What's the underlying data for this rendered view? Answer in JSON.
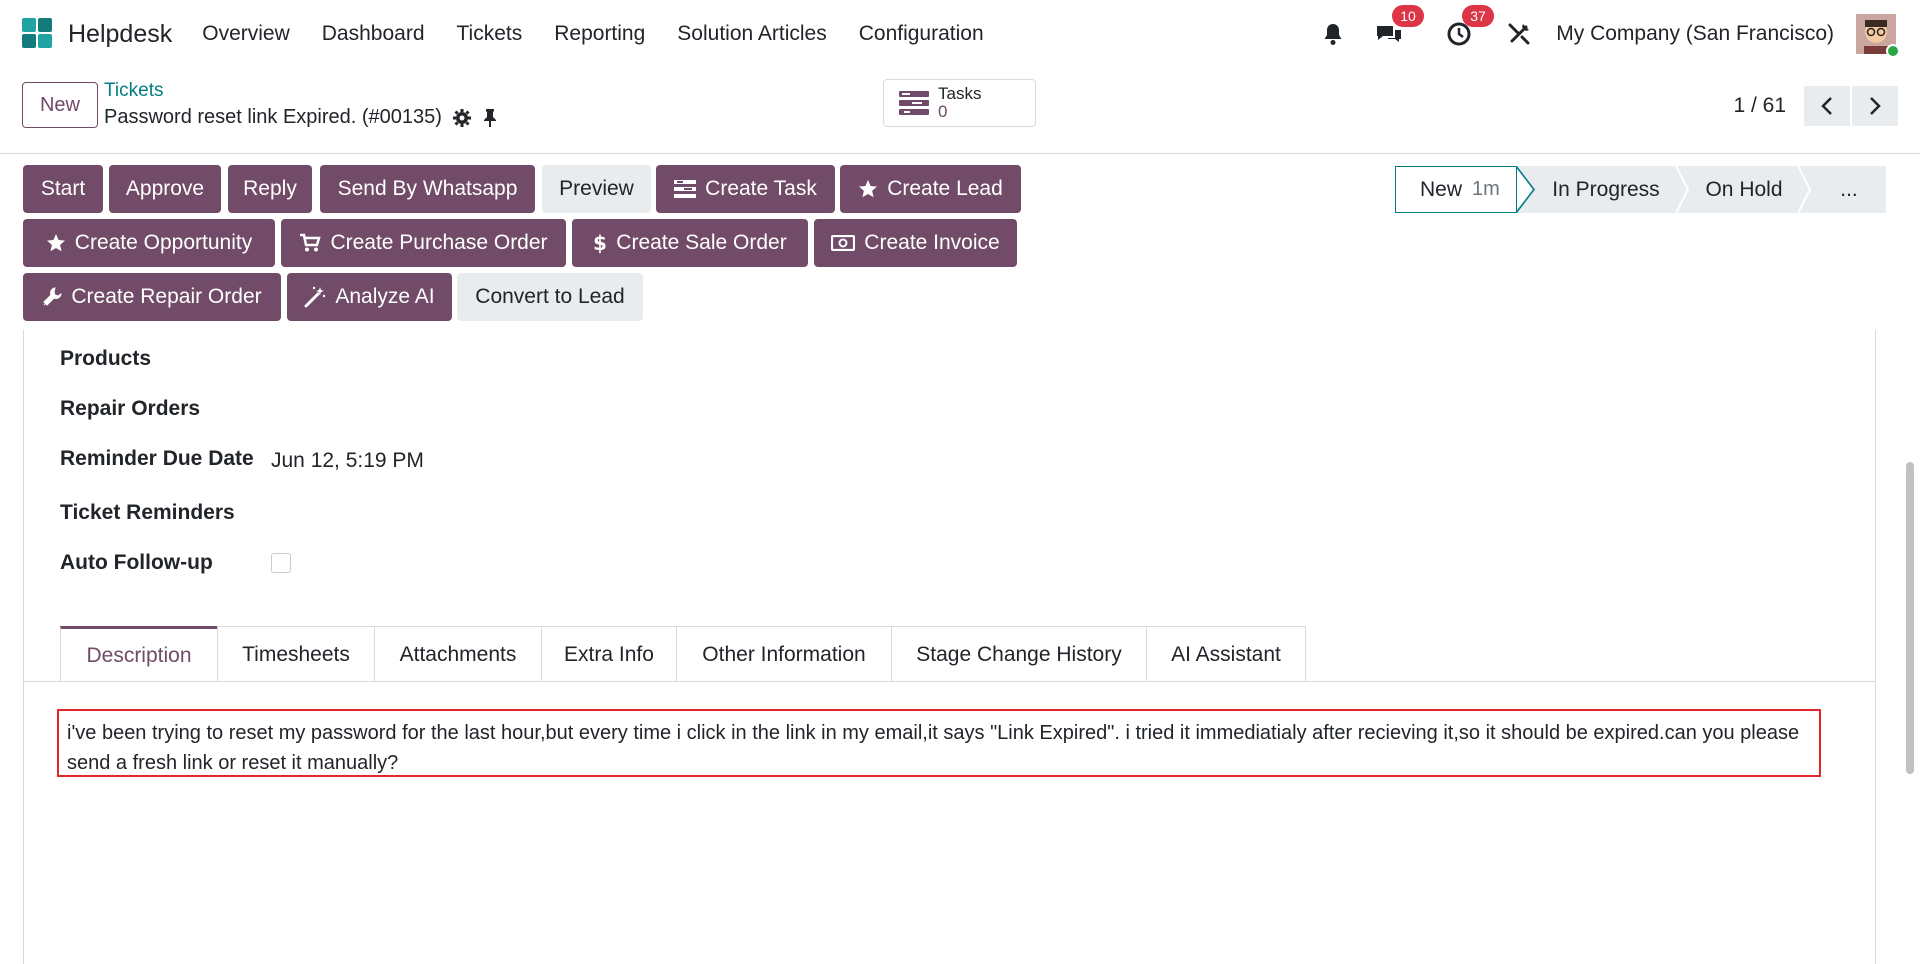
{
  "app": {
    "name": "Helpdesk",
    "menu": [
      "Overview",
      "Dashboard",
      "Tickets",
      "Reporting",
      "Solution Articles",
      "Configuration"
    ],
    "messages_count": "10",
    "activities_count": "37",
    "company": "My Company (San Francisco)"
  },
  "control": {
    "new_label": "New",
    "breadcrumb_parent": "Tickets",
    "record_title": "Password reset link Expired. (#00135)",
    "tasks_label": "Tasks",
    "tasks_count": "0",
    "pager_value": "1 / 61"
  },
  "actions": {
    "row1": [
      "Start",
      "Approve",
      "Reply",
      "Send By Whatsapp",
      "Preview",
      "Create Task",
      "Create Lead"
    ],
    "row2": [
      "Create Opportunity",
      "Create Purchase Order",
      "Create Sale Order",
      "Create Invoice"
    ],
    "row3": [
      "Create Repair Order",
      "Analyze AI",
      "Convert to Lead"
    ]
  },
  "stages": {
    "current": "New",
    "current_duration": "1m",
    "others": [
      "In Progress",
      "On Hold",
      "..."
    ]
  },
  "fields": {
    "products_label": "Products",
    "repair_orders_label": "Repair Orders",
    "reminder_due_date_label": "Reminder Due Date",
    "reminder_due_date_value": "Jun 12, 5:19 PM",
    "ticket_reminders_label": "Ticket Reminders",
    "auto_followup_label": "Auto Follow-up"
  },
  "tabs": [
    "Description",
    "Timesheets",
    "Attachments",
    "Extra Info",
    "Other Information",
    "Stage Change History",
    "AI Assistant"
  ],
  "description": "i've been trying to reset my password for the last hour,but every time i click in the link in my email,it says \"Link Expired\". i tried it immediatialy after recieving it,so it should be expired.can you please send a fresh link or reset it manually?",
  "colors": {
    "brand": "#714b67",
    "link": "#017e84",
    "badge": "#dc3545",
    "highlight_border": "#e3262b"
  }
}
